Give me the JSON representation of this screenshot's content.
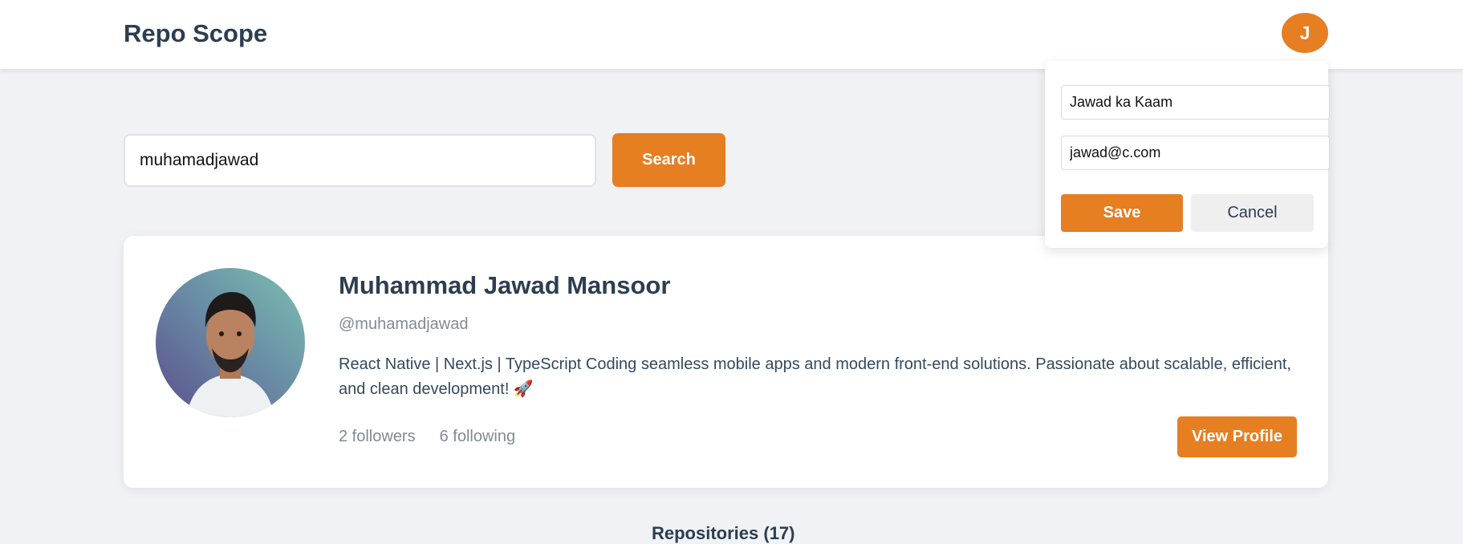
{
  "header": {
    "brand": "Repo Scope",
    "avatar_initial": "J"
  },
  "search": {
    "value": "muhamadjawad",
    "button_label": "Search"
  },
  "profile": {
    "name": "Muhammad Jawad Mansoor",
    "handle": "@muhamadjawad",
    "bio": "React Native | Next.js | TypeScript Coding seamless mobile apps and modern front-end solutions. Passionate about scalable, efficient, and clean development! 🚀",
    "followers": "2 followers",
    "following": "6 following",
    "view_button_label": "View Profile"
  },
  "edit_popover": {
    "name_value": "Jawad ka Kaam",
    "email_value": "jawad@c.com",
    "save_label": "Save",
    "cancel_label": "Cancel"
  },
  "section": {
    "title": "Repositories (17)"
  },
  "colors": {
    "accent": "#e67e22",
    "text_dark": "#2c3e50",
    "text_muted": "#808b96",
    "page_bg": "#f0f2f5"
  }
}
